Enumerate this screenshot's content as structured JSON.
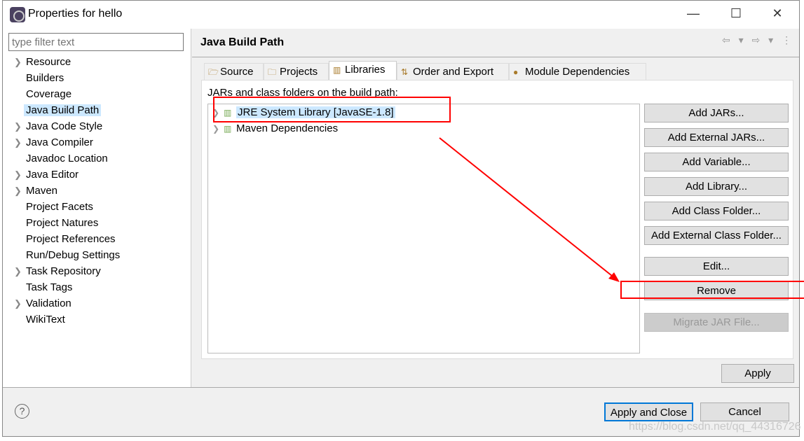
{
  "window": {
    "title": "Properties for hello",
    "minimize": "—",
    "maximize": "☐",
    "close": "✕"
  },
  "filter": {
    "placeholder": "type filter text"
  },
  "tree": [
    {
      "label": "Resource",
      "expandable": true
    },
    {
      "label": "Builders",
      "expandable": false
    },
    {
      "label": "Coverage",
      "expandable": false
    },
    {
      "label": "Java Build Path",
      "expandable": false,
      "selected": true
    },
    {
      "label": "Java Code Style",
      "expandable": true
    },
    {
      "label": "Java Compiler",
      "expandable": true
    },
    {
      "label": "Javadoc Location",
      "expandable": false
    },
    {
      "label": "Java Editor",
      "expandable": true
    },
    {
      "label": "Maven",
      "expandable": true
    },
    {
      "label": "Project Facets",
      "expandable": false
    },
    {
      "label": "Project Natures",
      "expandable": false
    },
    {
      "label": "Project References",
      "expandable": false
    },
    {
      "label": "Run/Debug Settings",
      "expandable": false
    },
    {
      "label": "Task Repository",
      "expandable": true
    },
    {
      "label": "Task Tags",
      "expandable": false
    },
    {
      "label": "Validation",
      "expandable": true
    },
    {
      "label": "WikiText",
      "expandable": false
    }
  ],
  "page": {
    "title": "Java Build Path",
    "nav": "⇦ ▾ ⇨ ▾ ⋮"
  },
  "tabs": [
    {
      "label": "Source",
      "icon": "source-folder-icon"
    },
    {
      "label": "Projects",
      "icon": "project-folder-icon"
    },
    {
      "label": "Libraries",
      "icon": "library-icon",
      "active": true
    },
    {
      "label": "Order and Export",
      "icon": "order-icon"
    },
    {
      "label": "Module Dependencies",
      "icon": "module-icon"
    }
  ],
  "libraries": {
    "label": "JARs and class folders on the build path:",
    "items": [
      {
        "label": "JRE System Library [JavaSE-1.8]",
        "selected": true
      },
      {
        "label": "Maven Dependencies"
      }
    ],
    "buttons": [
      {
        "label": "Add JARs..."
      },
      {
        "label": "Add External JARs..."
      },
      {
        "label": "Add Variable..."
      },
      {
        "label": "Add Library..."
      },
      {
        "label": "Add Class Folder..."
      },
      {
        "label": "Add External Class Folder..."
      },
      {
        "label": "Edit..."
      },
      {
        "label": "Remove"
      },
      {
        "label": "Migrate JAR File...",
        "disabled": true
      }
    ]
  },
  "apply": "Apply",
  "footer": {
    "help": "?",
    "apply_close": "Apply and Close",
    "cancel": "Cancel"
  },
  "watermark": "https://blog.csdn.net/qq_44316726",
  "colors": {
    "annotation": "#ff0000",
    "selection": "#cce8ff",
    "default_button_border": "#0078d7"
  }
}
